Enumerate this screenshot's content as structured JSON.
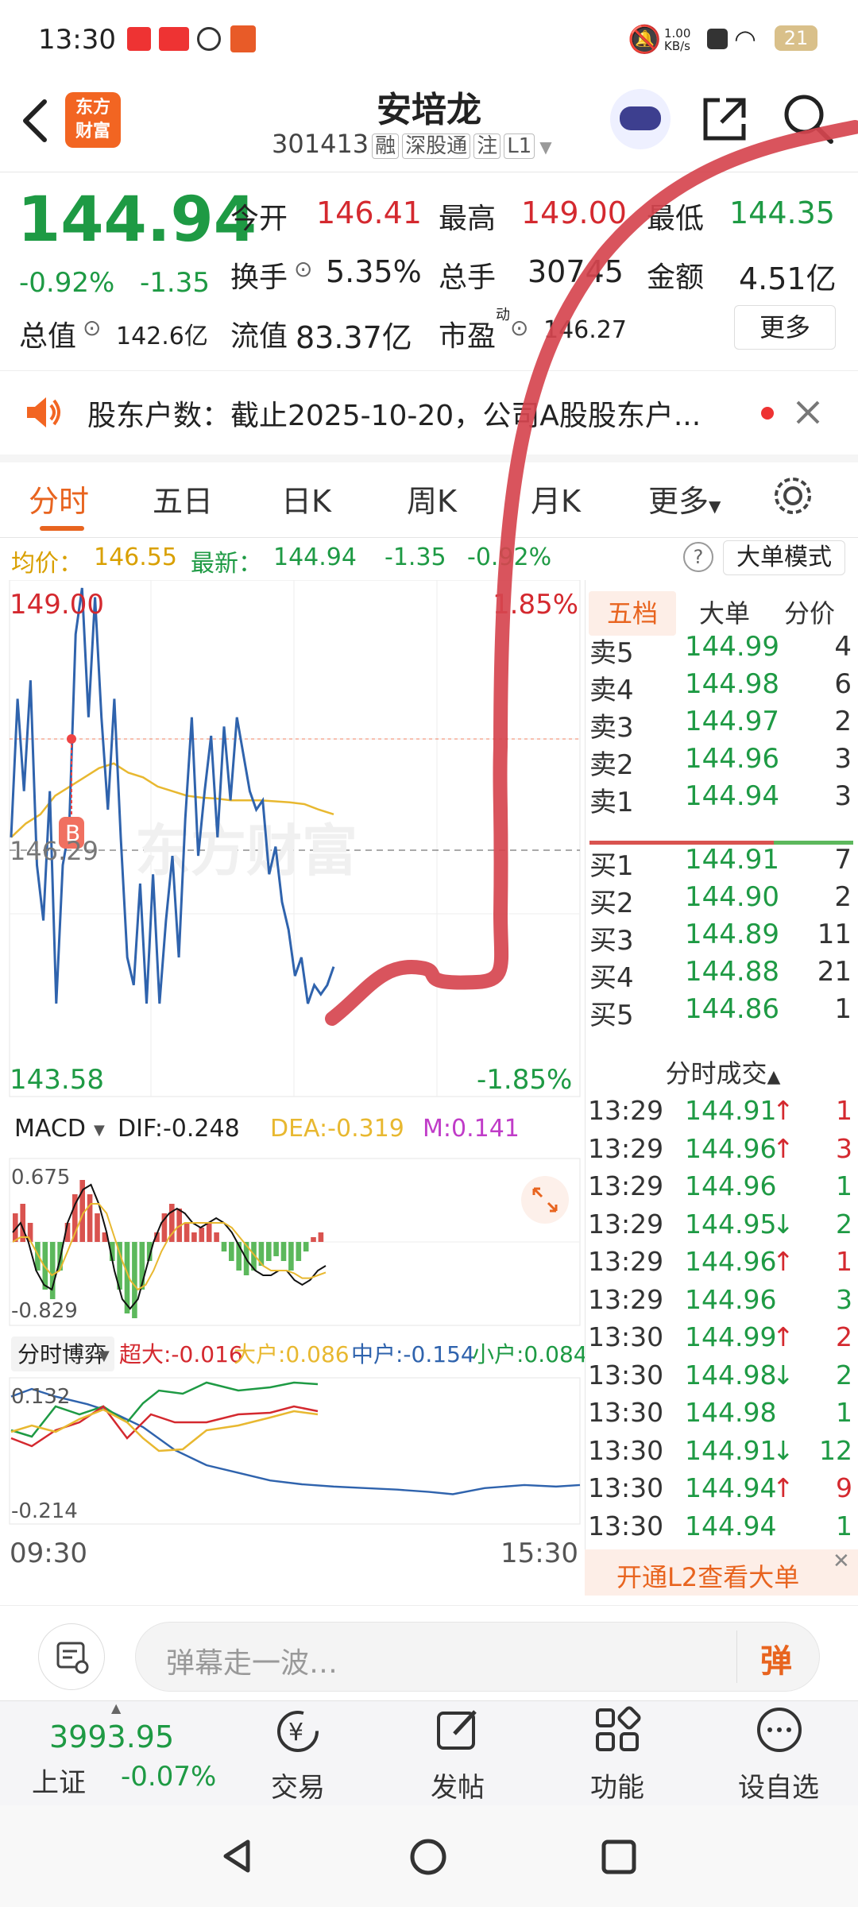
{
  "status": {
    "time": "13:30",
    "net_speed": "1.00\nKB/s",
    "battery": "21"
  },
  "header": {
    "logo": "东方\n财富",
    "stock_name": "安培龙",
    "stock_code": "301413",
    "tags": [
      "融",
      "深股通",
      "注",
      "L1"
    ]
  },
  "quote": {
    "price": "144.94",
    "change_pct": "-0.92%",
    "change": "-1.35",
    "open_label": "今开",
    "open": "146.41",
    "high_label": "最高",
    "high": "149.00",
    "low_label": "最低",
    "low": "144.35",
    "turnover_label": "换手",
    "turnover": "5.35%",
    "volume_label": "总手",
    "volume": "30745",
    "amount_label": "金额",
    "amount": "4.51亿",
    "mktcap_label": "总值",
    "mktcap": "142.6亿",
    "float_label": "流值",
    "float": "83.37亿",
    "pe_label": "市盈",
    "pe_sup": "动",
    "pe": "146.27",
    "more_button": "更多"
  },
  "notice": {
    "text": "股东户数：截止2025-10-20，公司A股股东户..."
  },
  "tabs": [
    "分时",
    "五日",
    "日K",
    "周K",
    "月K",
    "更多"
  ],
  "chart_info": {
    "avg_label": "均价：",
    "avg": "146.55",
    "latest_label": "最新：",
    "latest": "144.94",
    "change": "-1.35",
    "change_pct": "-0.92%",
    "big_order_mode": "大单模式"
  },
  "chart_data": {
    "type": "line",
    "y_max": "149.00",
    "y_min": "143.58",
    "y_mid": "146.29",
    "pct_max": "1.85%",
    "pct_min": "-1.85%",
    "x_start": "09:30",
    "x_end": "15:30",
    "watermark": "东方财富",
    "marker": "B",
    "ylim": [
      143.58,
      149.0
    ],
    "price": [
      146.3,
      147.8,
      146.8,
      148.0,
      146.0,
      145.4,
      146.8,
      144.5,
      146.0,
      146.4,
      148.5,
      149.0,
      147.6,
      148.9,
      147.6,
      146.6,
      147.8,
      146.3,
      145.0,
      144.7,
      145.8,
      144.5,
      145.9,
      144.5,
      145.4,
      146.1,
      145.0,
      146.5,
      147.6,
      146.1,
      146.8,
      147.4,
      146.3,
      147.5,
      146.7,
      147.6,
      147.2,
      146.8,
      146.6,
      146.7,
      145.9,
      146.2,
      145.6,
      145.3,
      144.8,
      145.0,
      144.5,
      144.7,
      144.6,
      144.7,
      144.9
    ],
    "avg": [
      146.3,
      146.45,
      146.55,
      146.75,
      146.85,
      146.95,
      147.05,
      147.1,
      147.0,
      146.95,
      146.85,
      146.8,
      146.75,
      146.73,
      146.72,
      146.7,
      146.7,
      146.7,
      146.69,
      146.68,
      146.66,
      146.6,
      146.55
    ],
    "macd_label": "MACD",
    "dif": "DIF:-0.248",
    "dea": "DEA:-0.319",
    "m": "M:0.141",
    "macd_top": "0.675",
    "macd_bottom": "-0.829",
    "macd_bars": [
      0.3,
      0.4,
      0.2,
      -0.3,
      -0.5,
      -0.6,
      -0.3,
      0.2,
      0.5,
      0.65,
      0.5,
      0.3,
      0.1,
      -0.2,
      -0.5,
      -0.75,
      -0.8,
      -0.5,
      -0.2,
      0.1,
      0.3,
      0.4,
      0.35,
      0.2,
      0.1,
      0.15,
      0.2,
      0.1,
      -0.1,
      -0.2,
      -0.3,
      -0.35,
      -0.3,
      -0.25,
      -0.2,
      -0.15,
      -0.2,
      -0.3,
      -0.2,
      -0.1,
      0.05,
      0.1
    ],
    "dif_line": [
      0.1,
      0.2,
      0.0,
      -0.3,
      -0.45,
      -0.5,
      -0.2,
      0.2,
      0.4,
      0.55,
      0.6,
      0.4,
      0.1,
      -0.3,
      -0.6,
      -0.7,
      -0.6,
      -0.3,
      0.0,
      0.2,
      0.3,
      0.35,
      0.3,
      0.2,
      0.15,
      0.2,
      0.25,
      0.2,
      0.1,
      -0.05,
      -0.2,
      -0.3,
      -0.35,
      -0.35,
      -0.3,
      -0.3,
      -0.4,
      -0.45,
      -0.4,
      -0.3,
      -0.25
    ],
    "dea_line": [
      0.0,
      0.05,
      0.05,
      -0.1,
      -0.25,
      -0.35,
      -0.3,
      -0.1,
      0.1,
      0.3,
      0.4,
      0.4,
      0.3,
      0.05,
      -0.2,
      -0.4,
      -0.5,
      -0.45,
      -0.3,
      -0.1,
      0.05,
      0.15,
      0.2,
      0.2,
      0.2,
      0.2,
      0.2,
      0.2,
      0.15,
      0.05,
      -0.05,
      -0.15,
      -0.25,
      -0.3,
      -0.3,
      -0.3,
      -0.33,
      -0.38,
      -0.38,
      -0.35,
      -0.32
    ],
    "flow_label": "分时博弈",
    "flow_super": "超大:-0.016",
    "flow_big": "大户:0.086",
    "flow_mid": "中户:-0.154",
    "flow_small": "小户:0.084",
    "flow_top": "0.132",
    "flow_bottom": "-0.214"
  },
  "order_book": {
    "tabs": [
      "五档",
      "大单",
      "分价"
    ],
    "asks": [
      {
        "label": "卖5",
        "price": "144.99",
        "vol": "4"
      },
      {
        "label": "卖4",
        "price": "144.98",
        "vol": "6"
      },
      {
        "label": "卖3",
        "price": "144.97",
        "vol": "2"
      },
      {
        "label": "卖2",
        "price": "144.96",
        "vol": "3"
      },
      {
        "label": "卖1",
        "price": "144.94",
        "vol": "3"
      }
    ],
    "bids": [
      {
        "label": "买1",
        "price": "144.91",
        "vol": "7"
      },
      {
        "label": "买2",
        "price": "144.90",
        "vol": "2"
      },
      {
        "label": "买3",
        "price": "144.89",
        "vol": "11"
      },
      {
        "label": "买4",
        "price": "144.88",
        "vol": "21"
      },
      {
        "label": "买5",
        "price": "144.86",
        "vol": "1"
      }
    ]
  },
  "trades": {
    "title": "分时成交",
    "rows": [
      {
        "time": "13:29",
        "price": "144.91",
        "dir": "↑",
        "vol": "1"
      },
      {
        "time": "13:29",
        "price": "144.96",
        "dir": "↑",
        "vol": "3"
      },
      {
        "time": "13:29",
        "price": "144.96",
        "dir": "",
        "vol": "1"
      },
      {
        "time": "13:29",
        "price": "144.95",
        "dir": "↓",
        "vol": "2"
      },
      {
        "time": "13:29",
        "price": "144.96",
        "dir": "↑",
        "vol": "1"
      },
      {
        "time": "13:29",
        "price": "144.96",
        "dir": "",
        "vol": "3"
      },
      {
        "time": "13:30",
        "price": "144.99",
        "dir": "↑",
        "vol": "2"
      },
      {
        "time": "13:30",
        "price": "144.98",
        "dir": "↓",
        "vol": "2"
      },
      {
        "time": "13:30",
        "price": "144.98",
        "dir": "",
        "vol": "1"
      },
      {
        "time": "13:30",
        "price": "144.91",
        "dir": "↓",
        "vol": "12"
      },
      {
        "time": "13:30",
        "price": "144.94",
        "dir": "↑",
        "vol": "9"
      },
      {
        "time": "13:30",
        "price": "144.94",
        "dir": "",
        "vol": "1"
      }
    ],
    "upgrade": "开通L2查看大单"
  },
  "comment": {
    "placeholder": "弹幕走一波…",
    "danmu": "弹"
  },
  "bottom_nav": {
    "index_value": "3993.95",
    "index_name": "上证",
    "index_change": "-0.07%",
    "items": [
      "交易",
      "发帖",
      "功能",
      "设自选"
    ]
  }
}
